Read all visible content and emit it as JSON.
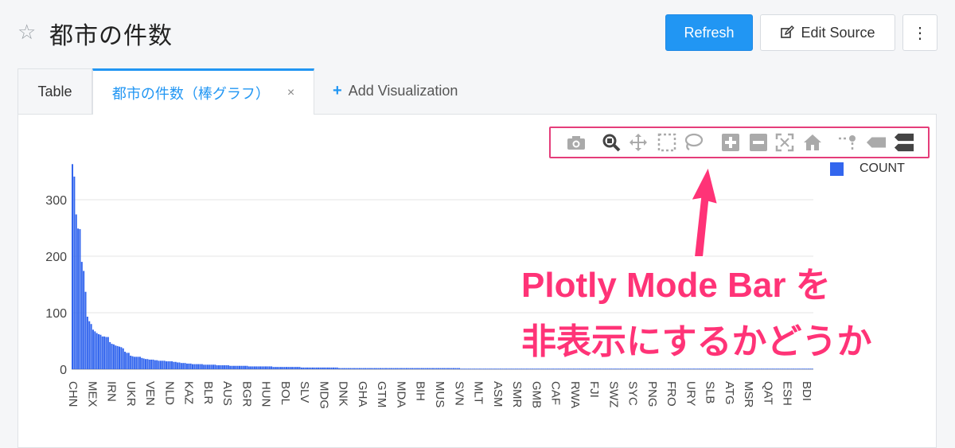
{
  "header": {
    "title": "都市の件数",
    "refresh_label": "Refresh",
    "edit_source_label": "Edit Source",
    "more_label": "⋮"
  },
  "tabs": {
    "table_label": "Table",
    "active_label": "都市の件数（棒グラフ）",
    "close_label": "×",
    "add_label": "Add Visualization"
  },
  "modebar": {
    "icons": [
      "camera-icon",
      "zoom-icon",
      "pan-icon",
      "box-select-icon",
      "lasso-icon",
      "zoom-in-icon",
      "zoom-out-icon",
      "autoscale-icon",
      "reset-axes-icon",
      "spike-lines-icon",
      "hover-closest-icon",
      "hover-compare-icon"
    ]
  },
  "annotation": {
    "line1": "Plotly Mode Bar を",
    "line2": "非表示にするかどうか",
    "color": "#ff3377"
  },
  "chart_data": {
    "type": "bar",
    "bar_color": "#3366ee",
    "legend": [
      "COUNT"
    ],
    "legend_position": "top-right",
    "ylim": [
      0,
      370
    ],
    "yticks": [
      0,
      100,
      200,
      300
    ],
    "grid": true,
    "xtick_labels": [
      "CHN",
      "MEX",
      "IRN",
      "UKR",
      "VEN",
      "NLD",
      "KAZ",
      "BLR",
      "AUS",
      "BGR",
      "HUN",
      "BOL",
      "SLV",
      "MDG",
      "DNK",
      "GHA",
      "GTM",
      "MDA",
      "BIH",
      "MUS",
      "SVN",
      "MLT",
      "ASM",
      "SMR",
      "GMB",
      "CAF",
      "RWA",
      "FJI",
      "SWZ",
      "SYC",
      "PNG",
      "FRO",
      "URY",
      "SLB",
      "ATG",
      "MSR",
      "QAT",
      "ESH",
      "BDI"
    ],
    "values": [
      363,
      341,
      274,
      249,
      248,
      190,
      174,
      137,
      93,
      85,
      80,
      70,
      67,
      64,
      62,
      61,
      58,
      58,
      57,
      57,
      48,
      45,
      44,
      42,
      41,
      40,
      39,
      37,
      31,
      29,
      29,
      24,
      23,
      22,
      22,
      22,
      22,
      20,
      19,
      18,
      18,
      17,
      17,
      17,
      16,
      16,
      15,
      15,
      15,
      15,
      14,
      14,
      14,
      14,
      13,
      13,
      12,
      12,
      11,
      11,
      11,
      10,
      10,
      10,
      9,
      9,
      9,
      9,
      9,
      9,
      8,
      8,
      8,
      8,
      8,
      8,
      8,
      7,
      7,
      7,
      7,
      7,
      7,
      7,
      6,
      6,
      6,
      6,
      6,
      6,
      6,
      6,
      6,
      6,
      5,
      5,
      5,
      5,
      5,
      5,
      5,
      5,
      5,
      5,
      5,
      5,
      5,
      4,
      4,
      4,
      4,
      4,
      4,
      4,
      4,
      4,
      4,
      4,
      4,
      4,
      4,
      4,
      3,
      3,
      3,
      3,
      3,
      3,
      3,
      3,
      3,
      3,
      3,
      3,
      3,
      3,
      3,
      3,
      3,
      3,
      3,
      3,
      2,
      2,
      2,
      2,
      2,
      2,
      2,
      2,
      2,
      2,
      2,
      2,
      2,
      2,
      2,
      2,
      2,
      2,
      2,
      2,
      2,
      2,
      2,
      2,
      2,
      2,
      2,
      2,
      2,
      2,
      2,
      2,
      2,
      2,
      2,
      2,
      2,
      2,
      2,
      2,
      2,
      2,
      2,
      2,
      2,
      2,
      2,
      2,
      2,
      2,
      2,
      2,
      2,
      2,
      2,
      2,
      2,
      2,
      2,
      2,
      2,
      2,
      2,
      2,
      2,
      1,
      1,
      1,
      1,
      1,
      1,
      1,
      1,
      1,
      1,
      1,
      1,
      1,
      1,
      1,
      1,
      1,
      1,
      1,
      1,
      1,
      1,
      1,
      1,
      1,
      1,
      1,
      1,
      1,
      1,
      1,
      1,
      1,
      1,
      1,
      1,
      1,
      1,
      1,
      1,
      1,
      1,
      1,
      1,
      1,
      1,
      1,
      1,
      1,
      1,
      1,
      1,
      1,
      1,
      1,
      1,
      1,
      1,
      1,
      1,
      1,
      1,
      1,
      1,
      1,
      1,
      1,
      1,
      1,
      1,
      1,
      1,
      1,
      1,
      1,
      1,
      1,
      1,
      1,
      1,
      1,
      1,
      1,
      1,
      1,
      1,
      1,
      1,
      1,
      1,
      1,
      1,
      1,
      1,
      1,
      1,
      1,
      1,
      1,
      1,
      1,
      1,
      1,
      1,
      1,
      1,
      1,
      1,
      1,
      1,
      1,
      1,
      1,
      1,
      1,
      1,
      1,
      1,
      1,
      1,
      1,
      1,
      1,
      1,
      1,
      1,
      1,
      1,
      1,
      1,
      1,
      1,
      1,
      1,
      1,
      1,
      1,
      1,
      1,
      1,
      1,
      1,
      1,
      1,
      1,
      1,
      1,
      1,
      1,
      1,
      1,
      1,
      1,
      1,
      1,
      1,
      1,
      1,
      1,
      1,
      1,
      1,
      1,
      1,
      1,
      1,
      1,
      1,
      1,
      1,
      1,
      1,
      1,
      1,
      1,
      1,
      1,
      1,
      1,
      1,
      1,
      1,
      1,
      1,
      1,
      1,
      1,
      1
    ]
  }
}
